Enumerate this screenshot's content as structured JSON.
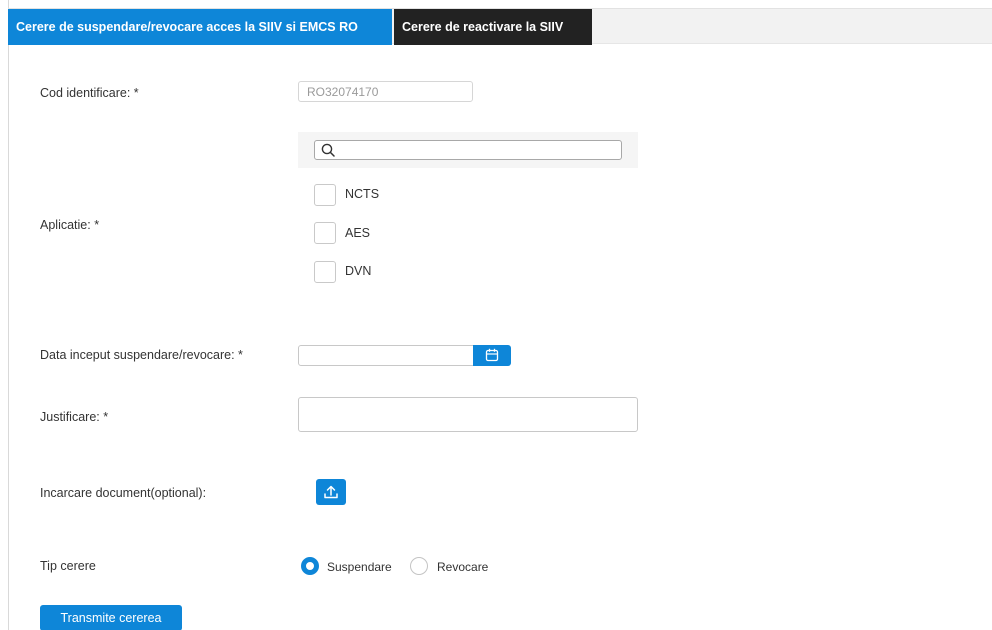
{
  "tabs": [
    {
      "label": "Cerere de suspendare/revocare acces la SIIV si EMCS RO",
      "active": true
    },
    {
      "label": "Cerere de reactivare la SIIV",
      "active": false
    }
  ],
  "form": {
    "cod": {
      "label": "Cod identificare: *",
      "value": "RO32074170"
    },
    "aplicatie": {
      "label": "Aplicatie: *",
      "search_value": "",
      "options": [
        {
          "label": "NCTS",
          "checked": false
        },
        {
          "label": "AES",
          "checked": false
        },
        {
          "label": "DVN",
          "checked": false
        }
      ]
    },
    "data_inceput": {
      "label": "Data inceput suspendare/revocare: *",
      "value": ""
    },
    "justificare": {
      "label": "Justificare: *",
      "value": ""
    },
    "document": {
      "label": "Incarcare document(optional):"
    },
    "tip_cerere": {
      "label": "Tip cerere",
      "options": [
        {
          "label": "Suspendare",
          "selected": true
        },
        {
          "label": "Revocare",
          "selected": false
        }
      ]
    },
    "submit_label": "Transmite cererea"
  },
  "colors": {
    "accent": "#0e86d8",
    "tab_inactive": "#222222"
  }
}
